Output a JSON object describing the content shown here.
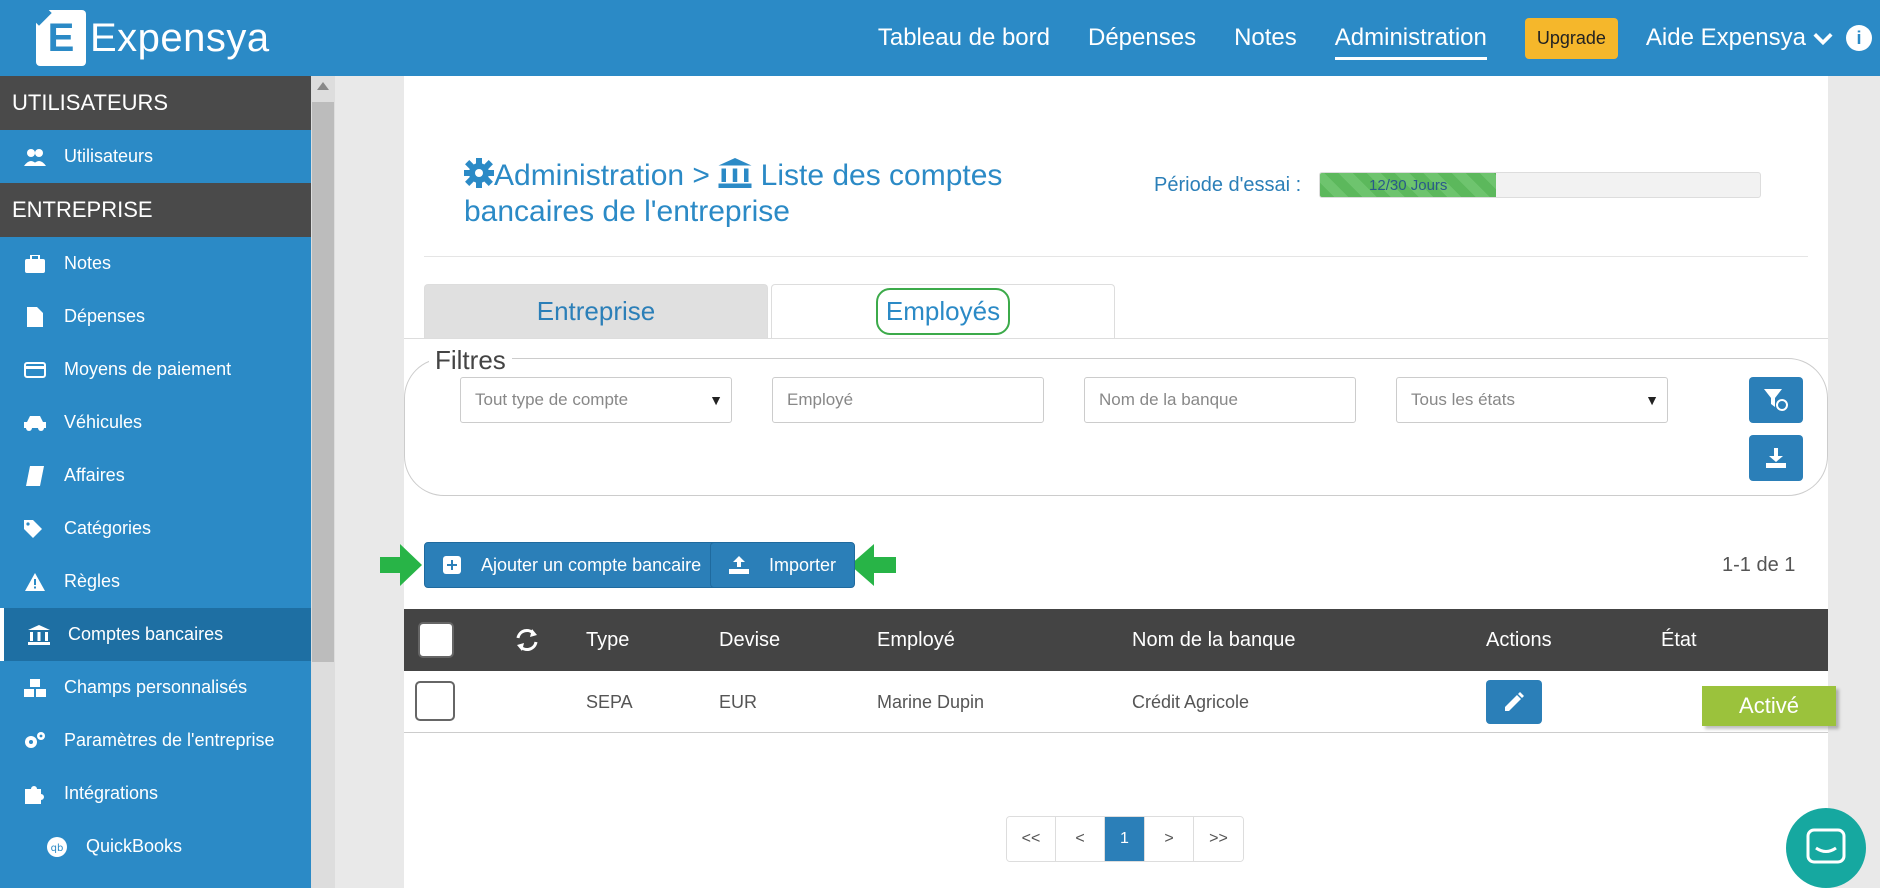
{
  "app": {
    "name": "Expensya",
    "logo_letter": "E"
  },
  "nav": {
    "items": [
      {
        "label": "Tableau de bord"
      },
      {
        "label": "Dépenses"
      },
      {
        "label": "Notes"
      },
      {
        "label": "Administration"
      }
    ],
    "upgrade": "Upgrade",
    "help": "Aide Expensya"
  },
  "sidebar": {
    "section1": "UTILISATEURS",
    "users": "Utilisateurs",
    "section2": "ENTREPRISE",
    "items": [
      "Notes",
      "Dépenses",
      "Moyens de paiement",
      "Véhicules",
      "Affaires",
      "Catégories",
      "Règles",
      "Comptes bancaires",
      "Champs personnalisés",
      "Paramètres de l'entreprise",
      "Intégrations",
      "QuickBooks"
    ]
  },
  "page": {
    "breadcrumb_root": "Administration",
    "breadcrumb_sep": ">",
    "breadcrumb_title": "Liste des comptes bancaires de l'entreprise",
    "trial_label": "Période d'essai :",
    "trial_text": "12/30 Jours",
    "trial_fraction": 0.4
  },
  "tabs": {
    "entreprise": "Entreprise",
    "employes": "Employés"
  },
  "filters": {
    "legend": "Filtres",
    "account_type": "Tout type de compte",
    "employee_placeholder": "Employé",
    "bank_placeholder": "Nom de la banque",
    "status": "Tous les états"
  },
  "actions": {
    "add": "Ajouter un compte bancaire",
    "import": "Importer",
    "count": "1-1 de 1"
  },
  "table": {
    "headers": [
      "Type",
      "Devise",
      "Employé",
      "Nom de la banque",
      "Actions",
      "État"
    ],
    "rows": [
      {
        "type": "SEPA",
        "devise": "EUR",
        "employe": "Marine Dupin",
        "banque": "Crédit Agricole",
        "etat": "Activé"
      }
    ]
  },
  "pagination": {
    "first": "<<",
    "prev": "<",
    "current": "1",
    "next": ">",
    "last": ">>"
  },
  "colors": {
    "primary": "#2b8ac6",
    "button": "#2b7fb8",
    "status_active": "#9bc23c",
    "upgrade": "#f5b72b",
    "arrow": "#28b447"
  }
}
